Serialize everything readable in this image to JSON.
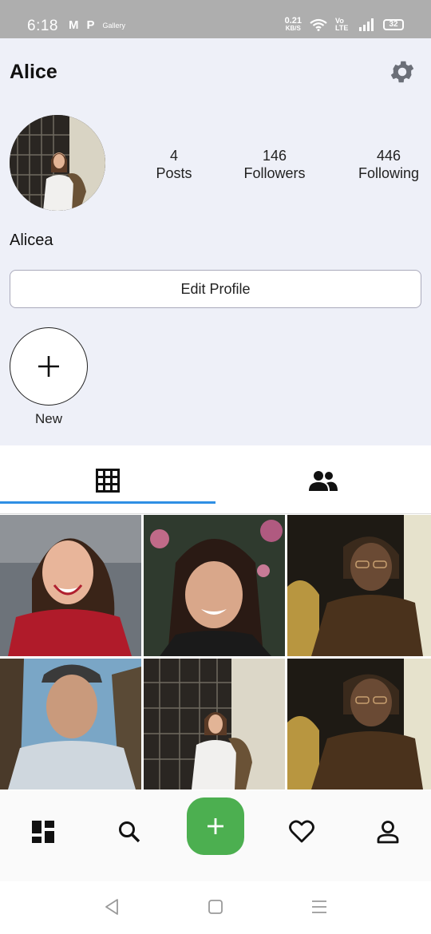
{
  "status_bar": {
    "time": "6:18",
    "left_icons": [
      "M",
      "P",
      "Gallery"
    ],
    "net_speed": "0.21",
    "net_unit": "KB/S",
    "network_label": "Vo LTE",
    "battery": "32"
  },
  "profile": {
    "username": "Alice",
    "display_name": "Alicea",
    "stats": [
      {
        "value": "4",
        "label": "Posts"
      },
      {
        "value": "146",
        "label": "Followers"
      },
      {
        "value": "446",
        "label": "Following"
      }
    ],
    "edit_label": "Edit Profile",
    "new_story_label": "New"
  },
  "tabs": {
    "active": "grid",
    "items": [
      "grid-icon",
      "people-icon"
    ]
  },
  "grid": {
    "tile_count": 6
  },
  "bottom_nav": {
    "items": [
      "dashboard-icon",
      "search-icon",
      "add-icon",
      "heart-icon",
      "person-icon"
    ],
    "accent": "#4caf50"
  },
  "colors": {
    "profile_bg": "#eef0f8",
    "tab_indicator": "#2f8fe4",
    "fab": "#4caf50"
  }
}
